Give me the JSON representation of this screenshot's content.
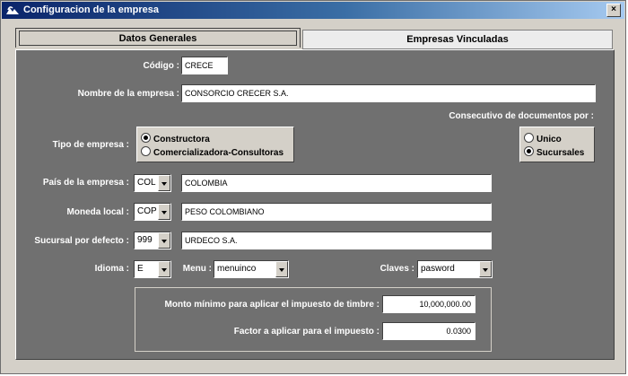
{
  "window": {
    "title": "Configuracion de la empresa",
    "close_label": "×"
  },
  "tabs": [
    {
      "label": "Datos Generales",
      "active": true
    },
    {
      "label": "Empresas Vinculadas",
      "active": false
    }
  ],
  "form": {
    "codigo_label": "Código :",
    "codigo_value": "CRECE",
    "nombre_label": "Nombre de la empresa :",
    "nombre_value": "CONSORCIO CRECER S.A.",
    "consecutivo_label": "Consecutivo de documentos por :",
    "tipo_label": "Tipo de empresa :",
    "tipo_options": [
      {
        "label": "Constructora",
        "selected": true
      },
      {
        "label": "Comercializadora-Consultoras",
        "selected": false
      }
    ],
    "consecutivo_options": [
      {
        "label": "Unico",
        "selected": false
      },
      {
        "label": "Sucursales",
        "selected": true
      }
    ],
    "pais_label": "País de la empresa :",
    "pais_code": "COL",
    "pais_name": "COLOMBIA",
    "moneda_label": "Moneda local :",
    "moneda_code": "COP",
    "moneda_name": "PESO COLOMBIANO",
    "sucursal_label": "Sucursal por defecto :",
    "sucursal_code": "999",
    "sucursal_name": "URDECO S.A.",
    "idioma_label": "Idioma :",
    "idioma_value": "E",
    "menu_label": "Menu :",
    "menu_value": "menuinco",
    "claves_label": "Claves :",
    "claves_value": "pasword",
    "monto_label": "Monto mínimo para aplicar el impuesto de timbre :",
    "monto_value": "10,000,000.00",
    "factor_label": "Factor a aplicar para el impuesto :",
    "factor_value": "0.0300"
  },
  "colors": {
    "panel": "#707070",
    "face": "#d4d0c8",
    "title_start": "#0a246a",
    "title_end": "#a6caf0"
  }
}
